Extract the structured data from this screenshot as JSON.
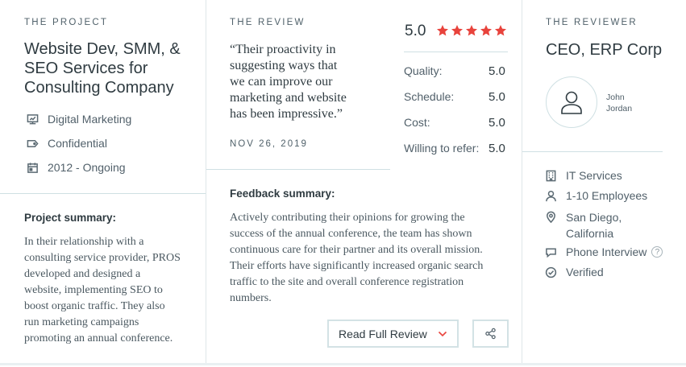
{
  "project": {
    "eyebrow": "THE PROJECT",
    "title_lines": [
      "Website Dev, SMM, &",
      "SEO Services for",
      "Consulting Company"
    ],
    "meta": [
      {
        "icon": "presentation-icon",
        "text": "Digital Marketing"
      },
      {
        "icon": "tag-icon",
        "text": "Confidential"
      },
      {
        "icon": "calendar-icon",
        "text": "2012 - Ongoing"
      }
    ],
    "summary_label": "Project summary:",
    "summary_lines": [
      "In their relationship with a",
      "consulting service provider, PROS",
      "developed and designed a",
      "website, implementing SEO to",
      "boost organic traffic. They also",
      "run marketing campaigns",
      "promoting an annual conference."
    ]
  },
  "review": {
    "eyebrow": "THE REVIEW",
    "quote_lines": [
      "“Their proactivity in",
      "suggesting ways that",
      "we can improve our",
      "marketing and website",
      "has been impressive.”"
    ],
    "date": "NOV 26, 2019",
    "overall": "5.0",
    "stars": 5,
    "star_color": "#e8433c",
    "ratings": [
      {
        "label": "Quality:",
        "value": "5.0"
      },
      {
        "label": "Schedule:",
        "value": "5.0"
      },
      {
        "label": "Cost:",
        "value": "5.0"
      },
      {
        "label": "Willing to refer:",
        "value": "5.0"
      }
    ],
    "feedback_label": "Feedback summary:",
    "feedback_lines": [
      "Actively contributing their opinions for growing the",
      "success of the annual conference, the team has shown",
      "continuous care for their partner and its overall mission.",
      "Their efforts have significantly increased organic search",
      "traffic to the site and overall conference registration",
      "numbers."
    ],
    "read_full_label": "Read Full Review",
    "share_icon": "share-icon"
  },
  "reviewer": {
    "eyebrow": "THE REVIEWER",
    "role": "CEO, ERP Corp",
    "name_lines": [
      "John",
      "Jordan"
    ],
    "details": [
      {
        "icon": "building-icon",
        "lines": [
          "IT Services"
        ]
      },
      {
        "icon": "user-icon",
        "lines": [
          "1-10 Employees"
        ]
      },
      {
        "icon": "location-pin-icon",
        "lines": [
          "San Diego,",
          "California"
        ]
      },
      {
        "icon": "chat-bubble-icon",
        "lines": [
          "Phone Interview"
        ],
        "help": "?"
      },
      {
        "icon": "check-circle-icon",
        "lines": [
          "Verified"
        ]
      }
    ]
  }
}
